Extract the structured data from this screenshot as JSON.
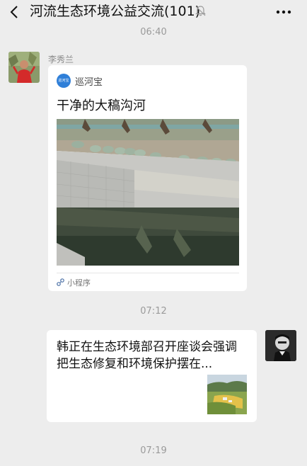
{
  "header": {
    "title": "河流生态环境公益交流(101)",
    "icons": {
      "back": "chevron-left-icon",
      "mute": "bell-off-icon",
      "more": "more-dots-icon"
    }
  },
  "messages": {
    "time1": "06:40",
    "msg1": {
      "sender": "李秀兰",
      "miniprogram": {
        "logo_text": "巡河宝",
        "name": "巡河宝",
        "title": "干净的大稿沟河",
        "footer": "小程序"
      }
    },
    "time2": "07:12",
    "msg2": {
      "article_title": "韩正在生态环境部召开座谈会强调 把生态修复和环境保护摆在..."
    },
    "time3": "07:19"
  },
  "colors": {
    "background": "#ededed",
    "card": "#ffffff",
    "timestamp": "#9a9a9a",
    "logo": "#2f7fd8"
  }
}
